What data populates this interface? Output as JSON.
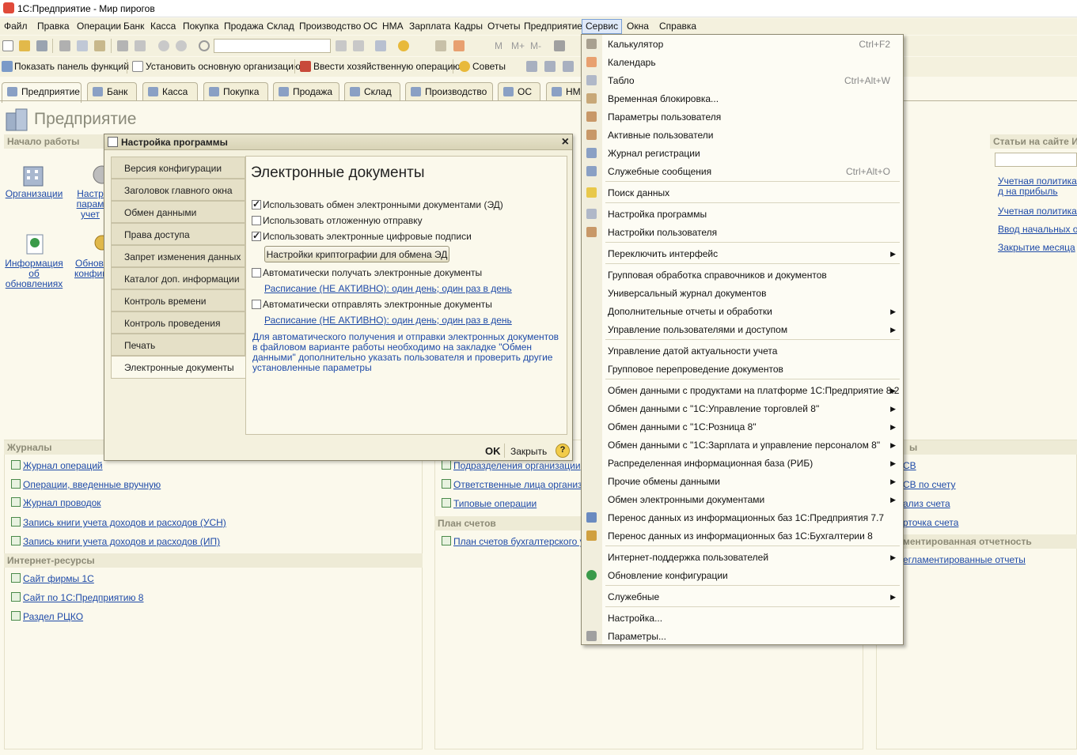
{
  "window": {
    "title": "1С:Предприятие - Мир пирогов"
  },
  "menubar": [
    "Файл",
    "Правка",
    "Операции",
    "Банк",
    "Касса",
    "Покупка",
    "Продажа",
    "Склад",
    "Производство",
    "ОС",
    "НМА",
    "Зарплата",
    "Кадры",
    "Отчеты",
    "Предприятие",
    "Сервис",
    "Окна",
    "Справка"
  ],
  "toolbar": {
    "show_panel": "Показать панель функций",
    "set_org": "Установить основную организацию",
    "enter_op": "Ввести хозяйственную операцию",
    "tips": "Советы",
    "m": "M",
    "mplus": "M+",
    "mminus": "M-"
  },
  "section_tabs": [
    "Предприятие",
    "Банк",
    "Касса",
    "Покупка",
    "Продажа",
    "Склад",
    "Производство",
    "ОС",
    "НМ"
  ],
  "page": {
    "title": "Предприятие",
    "start_header": "Начало работы",
    "big_links": [
      "Организации",
      "Настр парам учет",
      "Информация об обновлениях",
      "Обнов конфиг"
    ],
    "articles_header": "Статьи на сайте ИТ",
    "articles": [
      "Учетная политика д на прибыль",
      "Учетная политика д",
      "Ввод начальных ост",
      "Закрытие месяца"
    ],
    "journals_header": "Журналы",
    "journals": [
      "Журнал операций",
      "Операции, введенные вручную",
      "Журнал проводок",
      "Запись книги учета доходов и расходов (УСН)",
      "Запись книги учета доходов и расходов (ИП)"
    ],
    "internet_header": "Интернет-ресурсы",
    "internet": [
      "Сайт фирмы 1С",
      "Сайт по 1С:Предприятию 8",
      "Раздел РЦКО"
    ],
    "mid_links": [
      "Подразделения организации",
      "Ответственные лица организац",
      "Типовые операции"
    ],
    "accounts_header": "План счетов",
    "accounts": [
      "План счетов бухгалтерского уче"
    ],
    "right_header1": "ы",
    "right_links1": [
      "СВ",
      "СВ по счету",
      "ализ счета",
      "рточка счета"
    ],
    "right_header2": "ментированная отчетность",
    "right_links2": [
      "егламентированные отчеты"
    ]
  },
  "dialog": {
    "title": "Настройка программы",
    "tabs": [
      "Версия конфигурации",
      "Заголовок главного окна",
      "Обмен данными",
      "Права доступа",
      "Запрет изменения данных",
      "Каталог доп. информации",
      "Контроль времени",
      "Контроль проведения",
      "Печать",
      "Электронные документы"
    ],
    "heading": "Электронные документы",
    "cb_use_ed": "Использовать обмен электронными документами (ЭД)",
    "cb_deferred": "Использовать отложенную отправку",
    "cb_signatures": "Использовать электронные цифровые подписи",
    "crypto_button": "Настройки криптографии для обмена ЭД",
    "cb_auto_receive": "Автоматически получать электронные документы",
    "schedule1": "Расписание (НЕ АКТИВНО): один день; один раз в день",
    "cb_auto_send": "Автоматически отправлять электронные документы",
    "schedule2": "Расписание (НЕ АКТИВНО): один день; один раз в день",
    "note": "Для автоматического получения и отправки электронных документов в файловом варианте работы необходимо на закладке \"Обмен данными\" дополнительно указать пользователя и проверить другие установленные параметры",
    "ok": "OK",
    "close": "Закрыть",
    "help": "?"
  },
  "service_menu": {
    "items": [
      {
        "label": "Калькулятор",
        "shortcut": "Ctrl+F2"
      },
      {
        "label": "Календарь",
        "shortcut": ""
      },
      {
        "label": "Табло",
        "shortcut": "Ctrl+Alt+W"
      },
      {
        "label": "Временная блокировка...",
        "shortcut": ""
      },
      {
        "label": "Параметры пользователя",
        "shortcut": ""
      },
      {
        "label": "Активные пользователи",
        "shortcut": ""
      },
      {
        "label": "Журнал регистрации",
        "shortcut": ""
      },
      {
        "label": "Служебные сообщения",
        "shortcut": "Ctrl+Alt+O"
      },
      {
        "label": "Поиск данных",
        "shortcut": ""
      },
      {
        "label": "Настройка программы",
        "shortcut": ""
      },
      {
        "label": "Настройки пользователя",
        "shortcut": ""
      },
      {
        "label": "Переключить интерфейс",
        "shortcut": ""
      },
      {
        "label": "Групповая обработка справочников и документов",
        "shortcut": ""
      },
      {
        "label": "Универсальный журнал документов",
        "shortcut": ""
      },
      {
        "label": "Дополнительные отчеты и обработки",
        "shortcut": ""
      },
      {
        "label": "Управление пользователями и доступом",
        "shortcut": ""
      },
      {
        "label": "Управление датой актуальности учета",
        "shortcut": ""
      },
      {
        "label": "Групповое перепроведение документов",
        "shortcut": ""
      },
      {
        "label": "Обмен данными с продуктами на платформе 1С:Предприятие 8.2",
        "shortcut": ""
      },
      {
        "label": "Обмен данными с \"1С:Управление торговлей 8\"",
        "shortcut": ""
      },
      {
        "label": "Обмен данными с \"1С:Розница 8\"",
        "shortcut": ""
      },
      {
        "label": "Обмен данными с \"1С:Зарплата и управление персоналом 8\"",
        "shortcut": ""
      },
      {
        "label": "Распределенная информационная база (РИБ)",
        "shortcut": ""
      },
      {
        "label": "Прочие обмены данными",
        "shortcut": ""
      },
      {
        "label": "Обмен электронными документами",
        "shortcut": ""
      },
      {
        "label": "Перенос данных из информационных баз 1С:Предприятия 7.7",
        "shortcut": ""
      },
      {
        "label": "Перенос данных из информационных баз 1С:Бухгалтерии 8",
        "shortcut": ""
      },
      {
        "label": "Интернет-поддержка пользователей",
        "shortcut": ""
      },
      {
        "label": "Обновление конфигурации",
        "shortcut": ""
      },
      {
        "label": "Служебные",
        "shortcut": ""
      },
      {
        "label": "Настройка...",
        "shortcut": ""
      },
      {
        "label": "Параметры...",
        "shortcut": ""
      }
    ]
  },
  "colors": {
    "link": "#1e4aa8",
    "bg": "#fbf9ec",
    "panel_header": "#eeebd6",
    "menu_highlight": "#dfe9f8"
  }
}
